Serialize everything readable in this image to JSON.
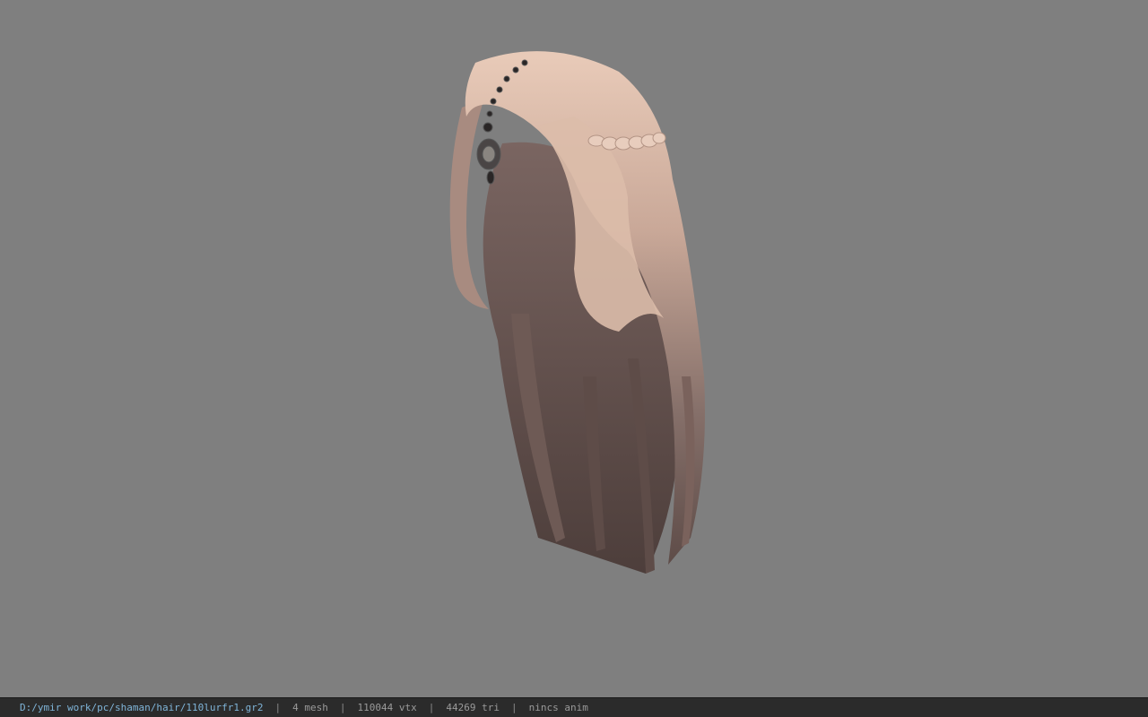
{
  "viewport": {
    "background_color": "#7f7f7f",
    "model_name": "hair-with-headpiece-model"
  },
  "status_bar": {
    "file_path": "D:/ymir work/pc/shaman/hair/110lurfr1.gr2",
    "separator": "|",
    "mesh_count": "4 mesh",
    "vertex_count": "110044 vtx",
    "triangle_count": "44269 tri",
    "anim_status": "nincs anim",
    "path_color": "#7fb4d8"
  }
}
